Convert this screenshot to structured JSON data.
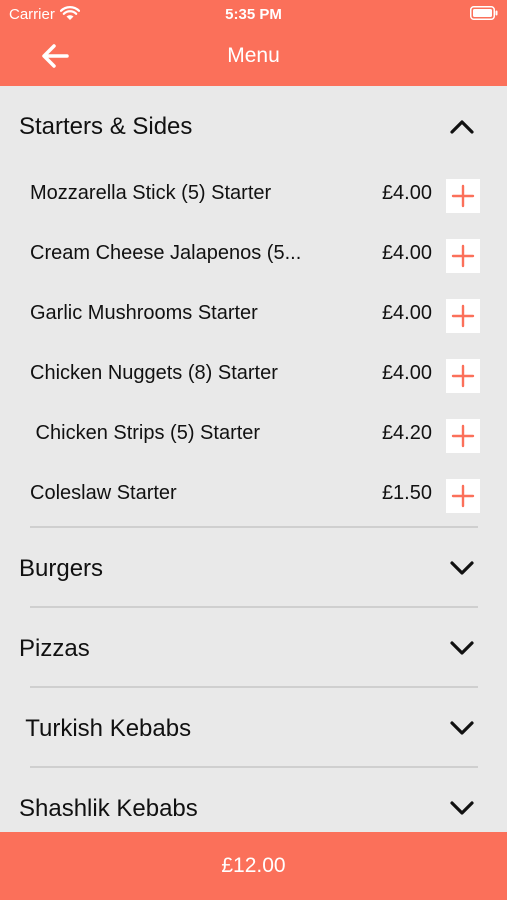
{
  "status_bar": {
    "carrier": "Carrier",
    "time": "5:35 PM"
  },
  "header": {
    "title": "Menu",
    "back_icon": "arrow-left-icon"
  },
  "colors": {
    "accent": "#fb705a",
    "background": "#e9e9e9",
    "divider": "#cfcfcf"
  },
  "sections": [
    {
      "title": "Starters & Sides",
      "expanded": true,
      "items": [
        {
          "name": "Mozzarella Stick (5) Starter",
          "price": "£4.00"
        },
        {
          "name": "Cream Cheese Jalapenos (5...",
          "price": "£4.00"
        },
        {
          "name": "Garlic Mushrooms Starter",
          "price": "£4.00"
        },
        {
          "name": "Chicken Nuggets (8) Starter",
          "price": "£4.00"
        },
        {
          "name": " Chicken Strips (5) Starter",
          "price": "£4.20"
        },
        {
          "name": "Coleslaw Starter",
          "price": "£1.50"
        }
      ]
    },
    {
      "title": "Burgers",
      "expanded": false
    },
    {
      "title": "Pizzas",
      "expanded": false
    },
    {
      "title": " Turkish Kebabs",
      "expanded": false
    },
    {
      "title": "Shashlik Kebabs",
      "expanded": false
    }
  ],
  "footer": {
    "total": "£12.00"
  }
}
